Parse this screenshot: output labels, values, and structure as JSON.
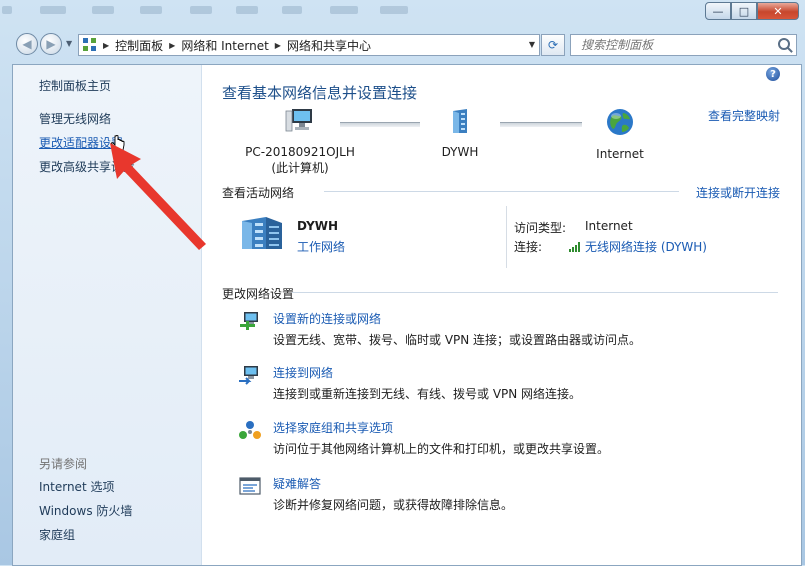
{
  "titlebar": {
    "minimize": "—",
    "maximize": "□",
    "close": "✕"
  },
  "address": {
    "crumbs": [
      "控制面板",
      "网络和 Internet",
      "网络和共享中心"
    ],
    "search_placeholder": "搜索控制面板"
  },
  "sidebar": {
    "home": "控制面板主页",
    "items": [
      "管理无线网络",
      "更改适配器设置",
      "更改高级共享设置"
    ],
    "see_also_title": "另请参阅",
    "see_also": [
      "Internet 选项",
      "Windows 防火墙",
      "家庭组"
    ]
  },
  "main": {
    "heading": "查看基本网络信息并设置连接",
    "full_map_link": "查看完整映射",
    "map": [
      {
        "label": "PC-20180921OJLH",
        "sublabel": "(此计算机)"
      },
      {
        "label": "DYWH",
        "sublabel": ""
      },
      {
        "label": "Internet",
        "sublabel": ""
      }
    ],
    "active_title": "查看活动网络",
    "connect_link": "连接或断开连接",
    "active_network": {
      "name": "DYWH",
      "type": "工作网络",
      "access_type_label": "访问类型:",
      "access_type_value": "Internet",
      "connection_label": "连接:",
      "connection_value": "无线网络连接 (DYWH)"
    },
    "change_title": "更改网络设置",
    "tasks": [
      {
        "link": "设置新的连接或网络",
        "desc": "设置无线、宽带、拨号、临时或 VPN 连接；或设置路由器或访问点。",
        "icon": "new-connection-icon"
      },
      {
        "link": "连接到网络",
        "desc": "连接到或重新连接到无线、有线、拨号或 VPN 网络连接。",
        "icon": "connect-network-icon"
      },
      {
        "link": "选择家庭组和共享选项",
        "desc": "访问位于其他网络计算机上的文件和打印机，或更改共享设置。",
        "icon": "homegroup-icon"
      },
      {
        "link": "疑难解答",
        "desc": "诊断并修复网络问题，或获得故障排除信息。",
        "icon": "troubleshoot-icon"
      }
    ]
  },
  "colors": {
    "link": "#1a5bb3",
    "heading": "#1d4f8a",
    "annotation_arrow": "#e8372d"
  }
}
